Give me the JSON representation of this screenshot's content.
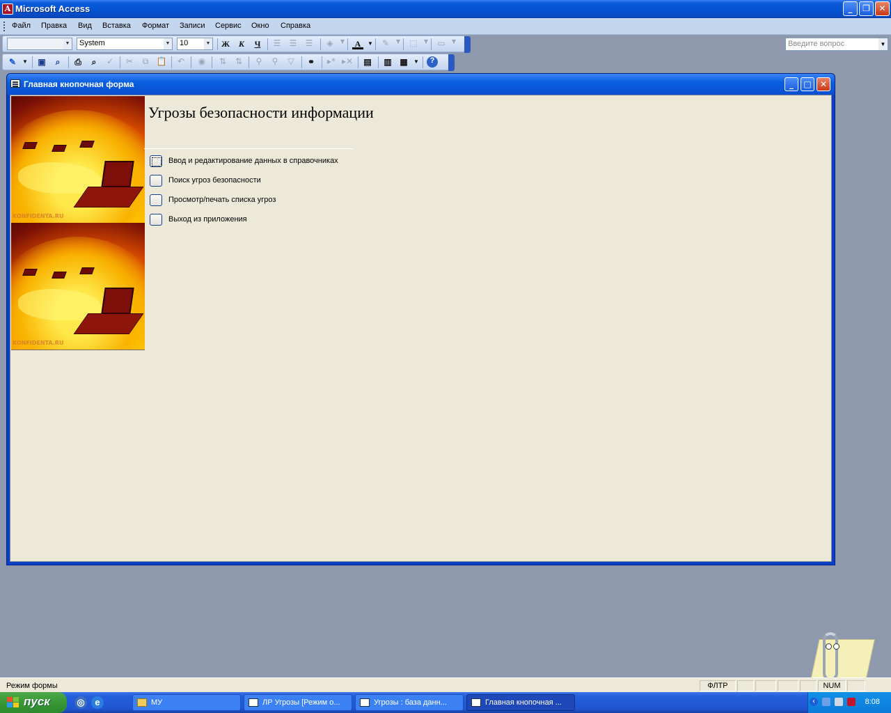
{
  "app": {
    "title": "Microsoft Access"
  },
  "menu": {
    "items": [
      "Файл",
      "Правка",
      "Вид",
      "Вставка",
      "Формат",
      "Записи",
      "Сервис",
      "Окно",
      "Справка"
    ]
  },
  "help": {
    "placeholder": "Введите вопрос"
  },
  "format_toolbar": {
    "object_combo": "",
    "font": "System",
    "size": "10",
    "bold": "Ж",
    "italic": "К",
    "underline": "Ч"
  },
  "form": {
    "window_title": "Главная кнопочная форма",
    "heading": "Угрозы безопасности информации",
    "image_watermark": "KONFIDENTA.RU",
    "buttons": [
      {
        "label": "Ввод и редактирование данных в справочниках"
      },
      {
        "label": "Поиск угроз безопасности"
      },
      {
        "label": "Просмотр/печать списка угроз"
      },
      {
        "label": "Выход из приложения"
      }
    ]
  },
  "status": {
    "text": "Режим формы",
    "filter": "ФЛТР",
    "num": "NUM"
  },
  "taskbar": {
    "start": "пуск",
    "tasks": [
      {
        "label": "МУ",
        "icon": "folder-icon"
      },
      {
        "label": "ЛР Угрозы [Режим о...",
        "icon": "word-doc-icon"
      },
      {
        "label": "Угрозы : база данн...",
        "icon": "access-db-icon"
      },
      {
        "label": "Главная кнопочная ...",
        "icon": "form-icon"
      }
    ],
    "clock": "8:08"
  },
  "colors": {
    "titlebar": "#0553d0",
    "form_bg": "#ece9d8",
    "workspace": "#8e99ad",
    "start_green": "#3c9a38"
  }
}
